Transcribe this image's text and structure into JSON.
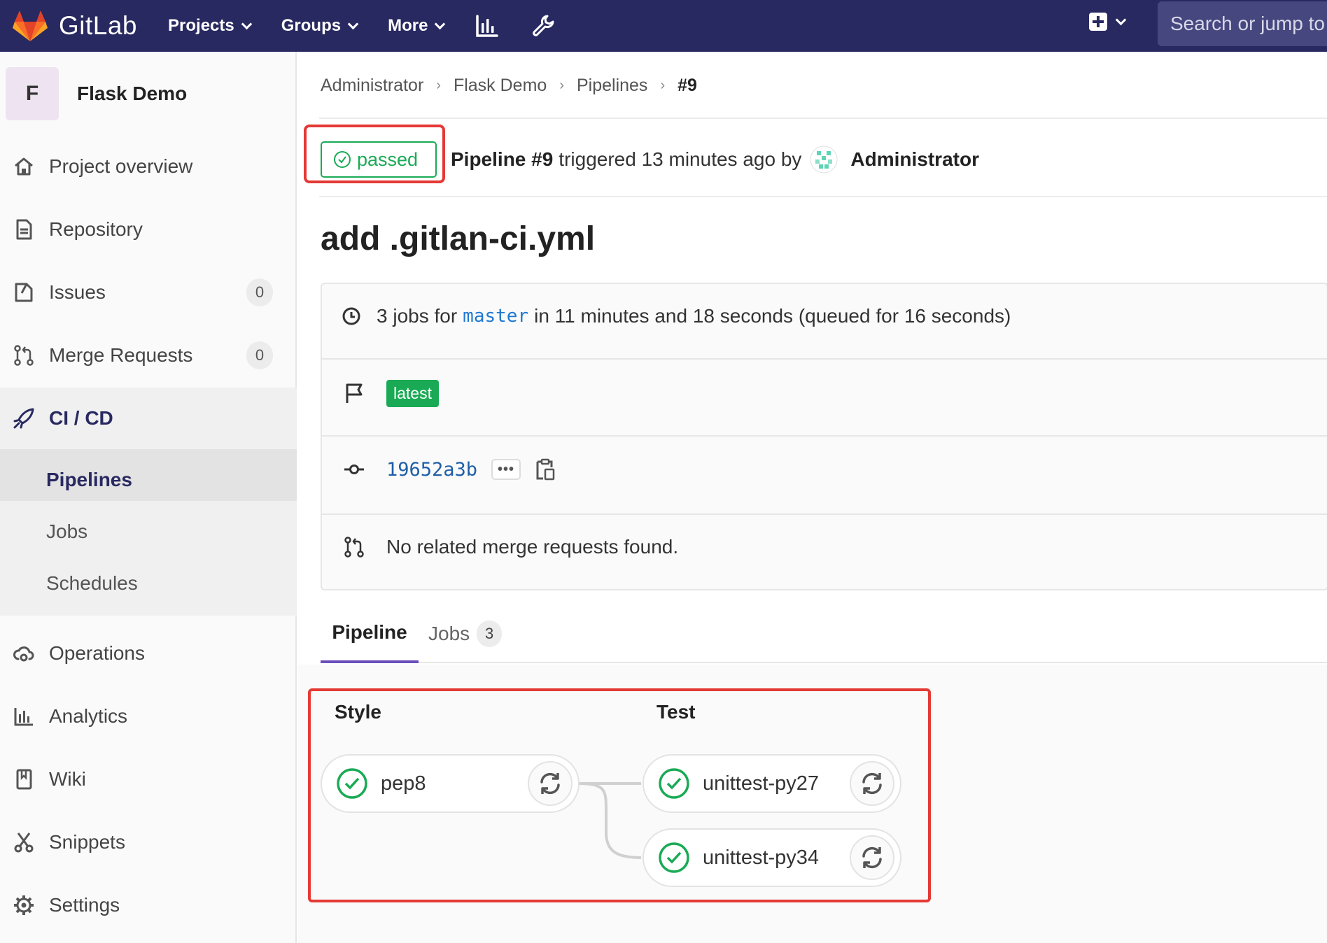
{
  "navbar": {
    "brand": "GitLab",
    "items": [
      {
        "label": "Projects",
        "icon": "chevron-down-icon"
      },
      {
        "label": "Groups",
        "icon": "chevron-down-icon"
      },
      {
        "label": "More",
        "icon": "chevron-down-icon"
      }
    ],
    "icons": [
      "activity-chart-icon",
      "wrench-icon",
      "plus-square-icon"
    ],
    "search_placeholder": "Search or jump to"
  },
  "sidebar": {
    "project_initial": "F",
    "project_name": "Flask Demo",
    "items": [
      {
        "label": "Project overview",
        "icon": "home-icon"
      },
      {
        "label": "Repository",
        "icon": "document-icon"
      },
      {
        "label": "Issues",
        "icon": "issues-icon",
        "count": "0"
      },
      {
        "label": "Merge Requests",
        "icon": "merge-request-icon",
        "count": "0"
      },
      {
        "label": "CI / CD",
        "icon": "rocket-icon"
      },
      {
        "label": "Operations",
        "icon": "cloud-gear-icon"
      },
      {
        "label": "Analytics",
        "icon": "chart-icon"
      },
      {
        "label": "Wiki",
        "icon": "book-icon"
      },
      {
        "label": "Snippets",
        "icon": "scissors-icon"
      },
      {
        "label": "Settings",
        "icon": "gear-icon"
      }
    ],
    "cicd_sub": [
      "Pipelines",
      "Jobs",
      "Schedules"
    ]
  },
  "breadcrumb": [
    "Administrator",
    "Flask Demo",
    "Pipelines",
    "#9"
  ],
  "pipeline": {
    "status": "passed",
    "title": "Pipeline #9",
    "triggered_text": "triggered 13 minutes ago by",
    "user": "Administrator",
    "commit_title": "add .gitlan-ci.yml",
    "jobs_prefix": "3 jobs for",
    "branch": "master",
    "duration_text": "in 11 minutes and 18 seconds (queued for 16 seconds)",
    "tag": "latest",
    "sha": "19652a3b",
    "more_label": "•••",
    "mr_text": "No related merge requests found."
  },
  "tabs": {
    "pipeline": "Pipeline",
    "jobs": "Jobs",
    "jobs_count": "3"
  },
  "graph": {
    "stages": [
      {
        "name": "Style",
        "jobs": [
          "pep8"
        ]
      },
      {
        "name": "Test",
        "jobs": [
          "unittest-py27",
          "unittest-py34"
        ]
      }
    ]
  },
  "colors": {
    "navbar": "#292961",
    "success": "#1aaa55",
    "link": "#1f78d1",
    "highlight": "#e53935"
  }
}
